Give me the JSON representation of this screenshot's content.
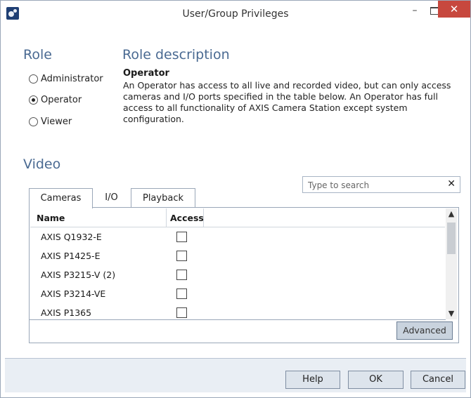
{
  "window": {
    "title": "User/Group Privileges",
    "minimize_glyph": "–",
    "close_glyph": "✕"
  },
  "role": {
    "heading": "Role",
    "options": [
      {
        "label": "Administrator",
        "selected": false
      },
      {
        "label": "Operator",
        "selected": true
      },
      {
        "label": "Viewer",
        "selected": false
      }
    ]
  },
  "role_description": {
    "heading": "Role description",
    "title": "Operator",
    "body": "An Operator has access to all live and recorded video, but can only access cameras and I/O ports specified in the table below. An Operator has full access to all functionality of AXIS Camera Station except system configuration."
  },
  "video": {
    "heading": "Video",
    "search_placeholder": "Type to search",
    "clear_glyph": "✕",
    "tabs": [
      {
        "label": "Cameras",
        "active": true
      },
      {
        "label": "I/O",
        "active": false
      },
      {
        "label": "Playback",
        "active": false
      }
    ],
    "table": {
      "columns": [
        "Name",
        "Access"
      ],
      "rows": [
        {
          "name": "AXIS Q1932-E",
          "access": false
        },
        {
          "name": "AXIS P1425-E",
          "access": false
        },
        {
          "name": "AXIS P3215-V (2)",
          "access": false
        },
        {
          "name": "AXIS P3214-VE",
          "access": false
        },
        {
          "name": "AXIS P1365",
          "access": false
        }
      ]
    },
    "advanced_label": "Advanced"
  },
  "footer": {
    "help_label": "Help",
    "ok_label": "OK",
    "cancel_label": "Cancel"
  }
}
